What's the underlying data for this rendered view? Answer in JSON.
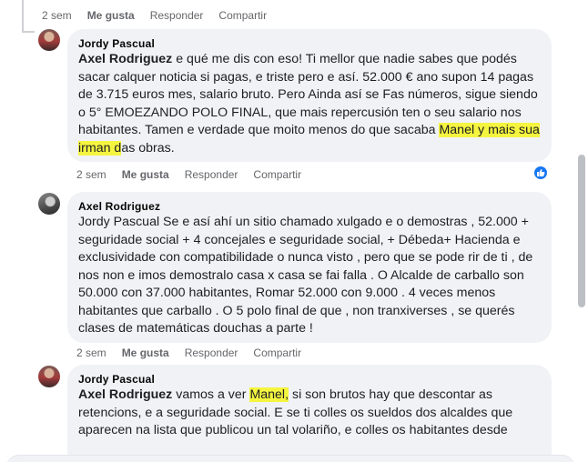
{
  "top_actions": {
    "time": "2 sem",
    "like": "Me gusta",
    "reply": "Responder",
    "share": "Compartir"
  },
  "comments": [
    {
      "author": "Jordy Pascual",
      "mention": "Axel Rodriguez",
      "text_a": " e qué me dis con eso! Ti mellor que nadie sabes que podés sacar calquer noticia si pagas, e triste pero e así. 52.000 € ano supon 14 pagas de 3.715 euros mes, salario bruto. Pero Ainda así se Fas números, sigue siendo o 5° EMOEZANDO POLO FINAL, que mais repercusión ten o seu salario nos habitantes. Tamen e verdade que moito menos do que sacaba ",
      "highlight": "Manel y mais sua irman d",
      "text_b": "as obras.",
      "actions": {
        "time": "2 sem",
        "like": "Me gusta",
        "reply": "Responder",
        "share": "Compartir"
      }
    },
    {
      "author": "Axel Rodriguez",
      "text": "Jordy Pascual Se e así ahí un sitio chamado xulgado e o demostras , 52.000 + seguridade social + 4 concejales e seguridade social, + Débeda+ Hacienda e exclusividade con compatibilidade o nunca visto , pero que se pode rir de ti , de nos non e imos demostralo casa x casa se fai falla . O Alcalde de carballo son 50.000 con 37.000 habitantes, Romar 52.000 con 9.000 . 4 veces menos habitantes que carballo . O 5 polo final de que , non tranxiverses , se querés clases de matemáticas douchas a parte !",
      "actions": {
        "time": "2 sem",
        "like": "Me gusta",
        "reply": "Responder",
        "share": "Compartir"
      }
    },
    {
      "author": "Jordy Pascual",
      "mention": "Axel Rodriguez",
      "text_a": " vamos a ver ",
      "highlight": "Manel,",
      "text_b": " si son brutos hay que descontar as retencions, e a seguridade social. E se ti colles os sueldos dos alcaldes que aparecen na lista que publicou un tal volariño, e colles os habitantes desde"
    }
  ],
  "colors": {
    "bubble": "#f0f2f5",
    "meta": "#65676b",
    "highlight": "#f5f540",
    "like_blue": "#1877f2"
  },
  "icons": {
    "reaction": "like-thumb-icon"
  }
}
